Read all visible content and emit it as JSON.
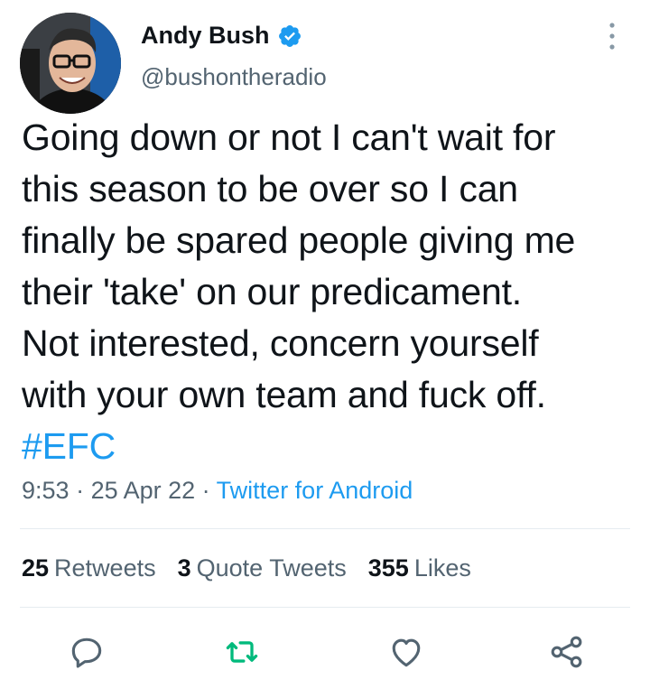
{
  "author": {
    "name": "Andy Bush",
    "handle": "@bushontheradio"
  },
  "tweet": {
    "lines": [
      "Going down or not I can't wait for",
      "this season to be over so I can",
      "finally be spared people giving me",
      "their 'take' on our predicament.",
      "Not interested, concern yourself",
      "with your own team and fuck off."
    ],
    "hashtag": "#EFC"
  },
  "meta": {
    "time": "9:53",
    "sep1": " · ",
    "date": "25 Apr 22",
    "sep2": " · ",
    "source": "Twitter for Android"
  },
  "stats": {
    "retweets_count": "25",
    "retweets_label": "Retweets",
    "quotes_count": "3",
    "quotes_label": "Quote Tweets",
    "likes_count": "355",
    "likes_label": "Likes"
  },
  "icons": {
    "verified": "verified-badge-icon",
    "more": "more-vertical-icon",
    "reply": "reply-icon",
    "retweet": "retweet-icon",
    "like": "like-heart-icon",
    "share": "share-icon"
  },
  "colors": {
    "accent": "#1d9bf0",
    "retweet_green": "#00ba7c",
    "secondary_text": "#536471",
    "icon_gray": "#536471"
  }
}
